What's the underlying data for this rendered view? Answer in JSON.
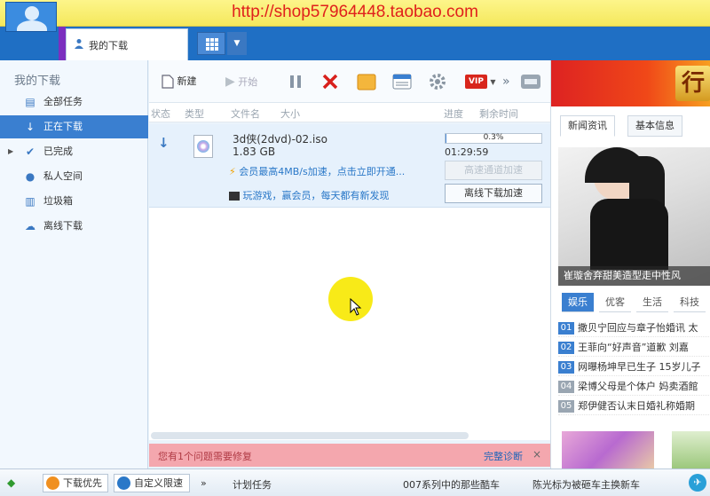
{
  "banner": {
    "url": "http://shop57964448.taobao.com"
  },
  "header": {
    "tab_label": "我的下载"
  },
  "sidebar": {
    "title": "我的下载",
    "items": [
      {
        "label": "全部任务",
        "icon": "document-icon"
      },
      {
        "label": "正在下载",
        "icon": "download-arrow-icon",
        "active": true
      },
      {
        "label": "已完成",
        "icon": "checkmark-icon"
      },
      {
        "label": "私人空间",
        "icon": "people-icon"
      },
      {
        "label": "垃圾箱",
        "icon": "trash-icon"
      },
      {
        "label": "离线下载",
        "icon": "cloud-download-icon"
      }
    ]
  },
  "toolbar": {
    "new_label": "新建",
    "start_label": "开始",
    "vip_label": "VIP"
  },
  "columns": {
    "status": "状态",
    "type": "类型",
    "filename": "文件名",
    "size": "大小",
    "progress": "进度",
    "remaining": "剩余时间"
  },
  "task": {
    "filename": "3d侠(2dvd)-02.iso",
    "size": "1.83 GB",
    "progress_text": "0.3%",
    "progress": 0.003,
    "remaining": "01:29:59",
    "vip_promo": "会员最高4MB/s加速，点击立即开通...",
    "game_promo": "玩游戏，赢会员，每天都有新发现",
    "accel_btn": "高速通道加速",
    "offline_btn": "离线下载加速"
  },
  "problem_bar": {
    "text": "您有1个问题需要修复",
    "fix": "完整诊断",
    "close": "×"
  },
  "right_panel": {
    "tabs": [
      "新闻资讯",
      "基本信息"
    ],
    "banner_char": "行",
    "photo_caption": "崔璇舍弃甜美造型走中性风",
    "categories": [
      "娱乐",
      "优客",
      "生活",
      "科技"
    ],
    "news": [
      {
        "num": "01",
        "title": "撒贝宁回应与章子怡婚讯 太"
      },
      {
        "num": "02",
        "title": "王菲向“好声音”道歉 刘嘉"
      },
      {
        "num": "03",
        "title": "网曝杨坤早已生子 15岁儿子"
      },
      {
        "num": "04",
        "title": "梁博父母是个体户 妈卖酒館"
      },
      {
        "num": "05",
        "title": "郑伊健否认末日婚礼称婚期"
      }
    ]
  },
  "statusbar": {
    "dl_priority": "下载优先",
    "custom_limit": "自定义限速",
    "more": "»",
    "plan": "计划任务",
    "ticker1": "007系列中的那些酷车",
    "ticker2": "陈光标为被砸车主换新车"
  },
  "colors": {
    "accent": "#3a7fd0",
    "banner_text": "#e0201c",
    "topbar": "#1f6fc4"
  }
}
